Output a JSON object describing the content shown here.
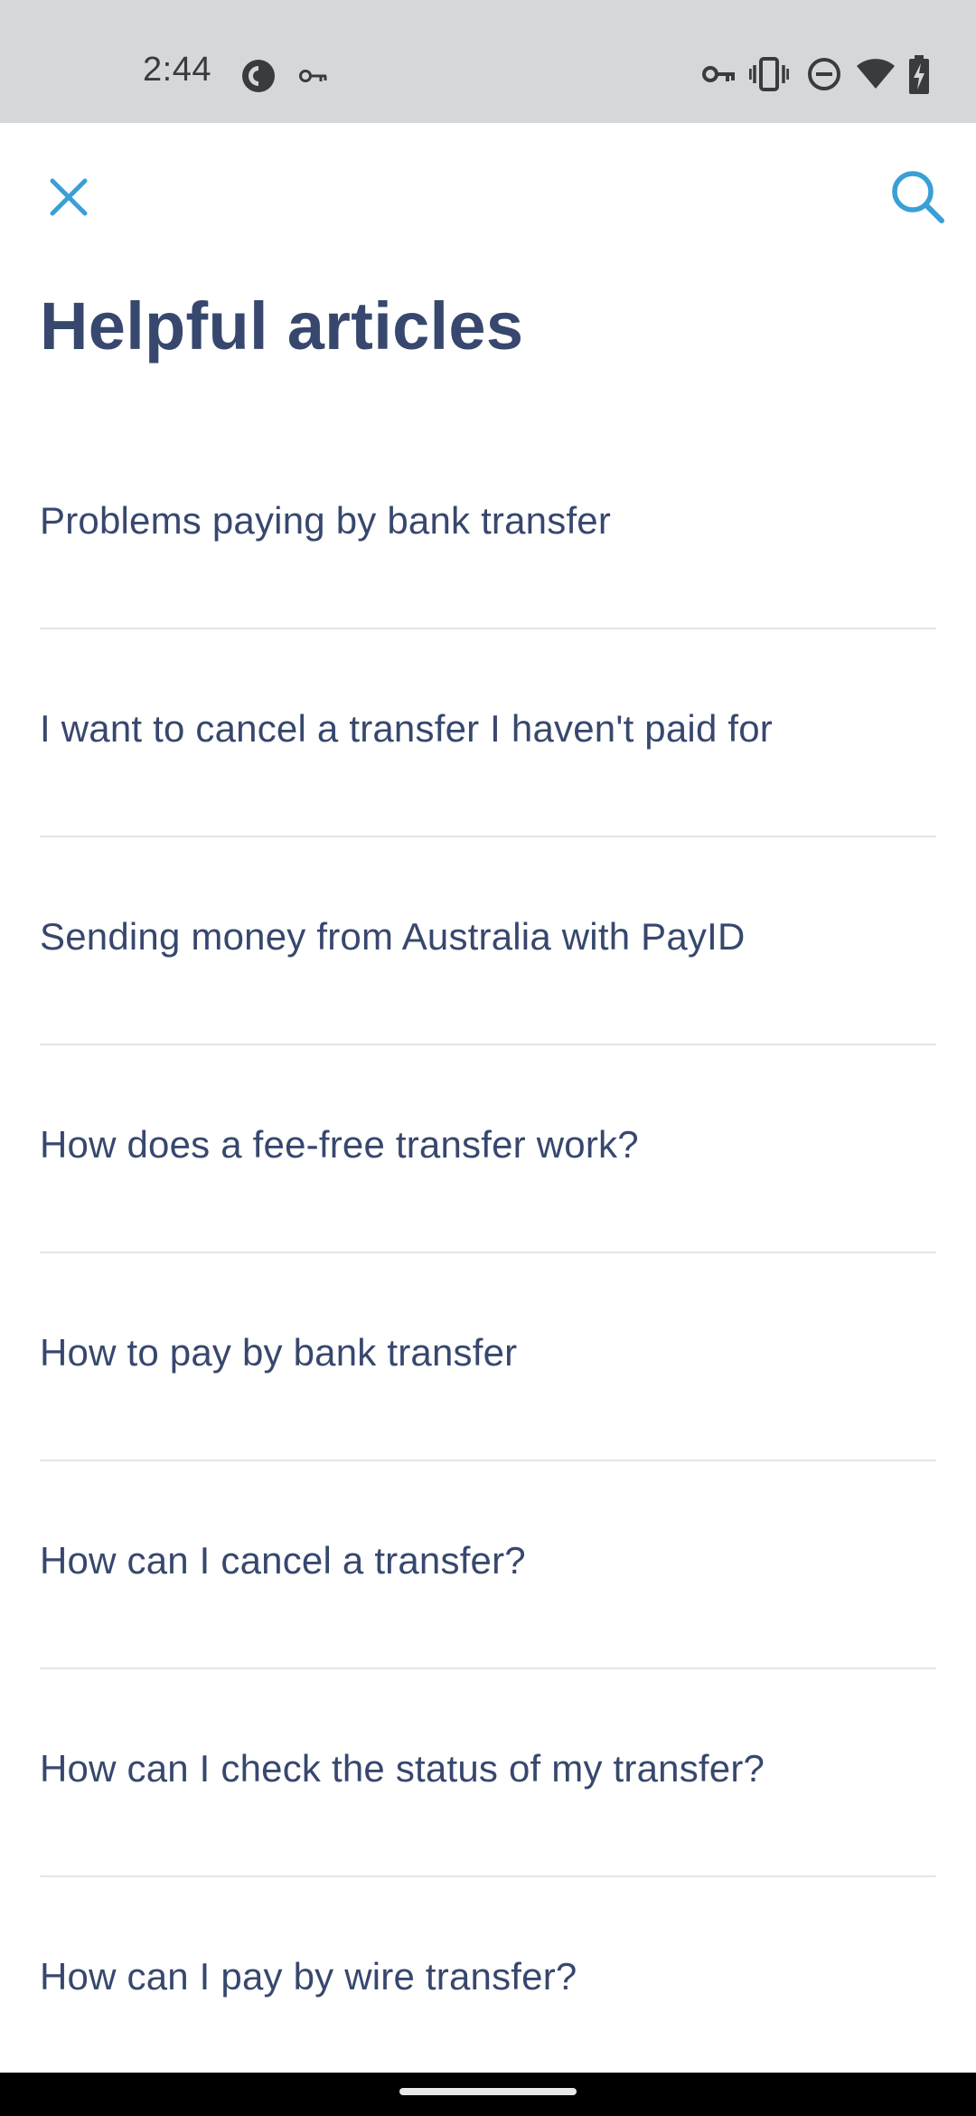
{
  "status_bar": {
    "time": "2:44",
    "icons": [
      "pocket-casts-icon",
      "vpn-key-icon",
      "vpn-key-icon",
      "vibrate-icon",
      "do-not-disturb-icon",
      "wifi-icon",
      "battery-charging-icon"
    ]
  },
  "toolbar": {
    "close_icon": "close-icon",
    "search_icon": "search-icon",
    "accent_color": "#3a9fd6"
  },
  "page": {
    "title": "Helpful articles",
    "text_color": "#37476e"
  },
  "articles": [
    {
      "label": "Problems paying by bank transfer"
    },
    {
      "label": "I want to cancel a transfer I haven't paid for"
    },
    {
      "label": "Sending money from Australia with PayID"
    },
    {
      "label": "How does a fee-free transfer work?"
    },
    {
      "label": "How to pay by bank transfer"
    },
    {
      "label": "How can I cancel a transfer?"
    },
    {
      "label": "How can I check the status of my transfer?"
    },
    {
      "label": "How can I pay by wire transfer?"
    }
  ]
}
